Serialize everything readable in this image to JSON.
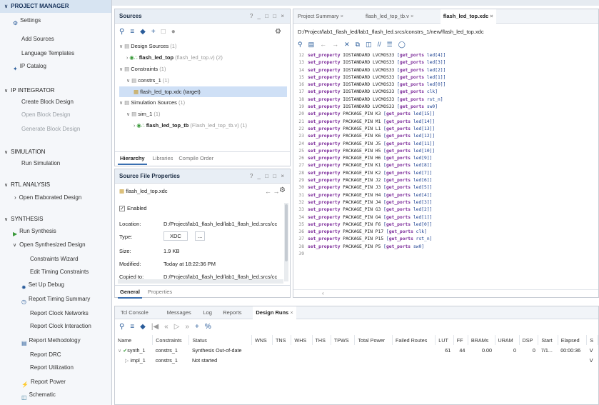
{
  "nav": {
    "items": [
      {
        "label": "PROJECT MANAGER",
        "kind": "section-top"
      },
      {
        "label": "Settings",
        "kind": "item"
      },
      {
        "label": "Add Sources",
        "kind": "sub"
      },
      {
        "label": "Language Templates",
        "kind": "sub"
      },
      {
        "label": "IP Catalog",
        "kind": "item"
      },
      {
        "label": "IP INTEGRATOR",
        "kind": "section"
      },
      {
        "label": "Create Block Design",
        "kind": "sub"
      },
      {
        "label": "Open Block Design",
        "kind": "sub-dim"
      },
      {
        "label": "Generate Block Design",
        "kind": "sub-dim"
      },
      {
        "label": "SIMULATION",
        "kind": "section"
      },
      {
        "label": "Run Simulation",
        "kind": "sub"
      },
      {
        "label": "RTL ANALYSIS",
        "kind": "section"
      },
      {
        "label": "Open Elaborated Design",
        "kind": "sub"
      },
      {
        "label": "SYNTHESIS",
        "kind": "section"
      },
      {
        "label": "Run Synthesis",
        "kind": "item"
      },
      {
        "label": "Open Synthesized Design",
        "kind": "item"
      },
      {
        "label": "Constraints Wizard",
        "kind": "sub2"
      },
      {
        "label": "Edit Timing Constraints",
        "kind": "sub2"
      },
      {
        "label": "Set Up Debug",
        "kind": "sub2i"
      },
      {
        "label": "Report Timing Summary",
        "kind": "sub2i"
      },
      {
        "label": "Report Clock Networks",
        "kind": "sub2"
      },
      {
        "label": "Report Clock Interaction",
        "kind": "sub2"
      },
      {
        "label": "Report Methodology",
        "kind": "sub2i"
      },
      {
        "label": "Report DRC",
        "kind": "sub2"
      },
      {
        "label": "Report Utilization",
        "kind": "sub2"
      },
      {
        "label": "Report Power",
        "kind": "sub2i"
      },
      {
        "label": "Schematic",
        "kind": "sub2i"
      }
    ]
  },
  "sources": {
    "title": "Sources",
    "controls": "? _ □ □ ×",
    "tree": [
      {
        "text": "Design Sources",
        "count": "(1)",
        "depth": 0
      },
      {
        "text": "flash_led_top",
        "extra": "(flash_led_top.v) (2)",
        "depth": 1,
        "bold": true
      },
      {
        "text": "Constraints",
        "count": "(1)",
        "depth": 0
      },
      {
        "text": "constrs_1",
        "count": "(1)",
        "depth": 1
      },
      {
        "text": "flash_led_top.xdc (target)",
        "depth": 2,
        "selected": true
      },
      {
        "text": "Simulation Sources",
        "count": "(1)",
        "depth": 0
      },
      {
        "text": "sim_1",
        "count": "(1)",
        "depth": 1
      },
      {
        "text": "flash_led_top_tb",
        "extra": "(Flash_led_top_tb.v) (1)",
        "depth": 2,
        "bold": true
      }
    ],
    "tabs": [
      "Hierarchy",
      "Libraries",
      "Compile Order"
    ]
  },
  "props": {
    "title": "Source File Properties",
    "controls": "? _ □ □ ×",
    "file": "flash_led_top.xdc",
    "enabled_label": "Enabled",
    "fields": [
      {
        "label": "Location:",
        "value": "D:/Project/lab1_flash_led/lab1_flash_led.srcs/cc"
      },
      {
        "label": "Type:",
        "value": "XDC"
      },
      {
        "label": "Size:",
        "value": "1.9 KB"
      },
      {
        "label": "Modified:",
        "value": "Today at 18:22:36 PM"
      },
      {
        "label": "Copied to:",
        "value": "D:/Project/lab1_flash_led/lab1_flash_led.srcs/cc"
      }
    ],
    "tabs": [
      "General",
      "Properties"
    ]
  },
  "editor": {
    "tabs": [
      "Project Summary",
      "flash_led_top_tb.v",
      "flash_led_top.xdc"
    ],
    "path": "D:/Project/lab1_flash_led/lab1_flash_led.srcs/constrs_1/new/flash_led_top.xdc",
    "lines": [
      {
        "n": "12",
        "kind": "io",
        "arg": "led[4]"
      },
      {
        "n": "13",
        "kind": "io",
        "arg": "led[3]"
      },
      {
        "n": "14",
        "kind": "io",
        "arg": "led[2]"
      },
      {
        "n": "15",
        "kind": "io",
        "arg": "led[1]"
      },
      {
        "n": "16",
        "kind": "io",
        "arg": "led[0]"
      },
      {
        "n": "17",
        "kind": "io",
        "arg": "clk"
      },
      {
        "n": "18",
        "kind": "io",
        "arg": "rst_n"
      },
      {
        "n": "19",
        "kind": "io",
        "arg": "sw0"
      },
      {
        "n": "20",
        "kind": "pin",
        "pin": "K3",
        "arg": "led[15]"
      },
      {
        "n": "21",
        "kind": "pin",
        "pin": "M1",
        "arg": "led[14]"
      },
      {
        "n": "22",
        "kind": "pin",
        "pin": "L1",
        "arg": "led[13]"
      },
      {
        "n": "23",
        "kind": "pin",
        "pin": "K6",
        "arg": "led[12]"
      },
      {
        "n": "24",
        "kind": "pin",
        "pin": "J5",
        "arg": "led[11]"
      },
      {
        "n": "25",
        "kind": "pin",
        "pin": "H5",
        "arg": "led[10]"
      },
      {
        "n": "26",
        "kind": "pin",
        "pin": "H6",
        "arg": "led[9]"
      },
      {
        "n": "27",
        "kind": "pin",
        "pin": "K1",
        "arg": "led[8]"
      },
      {
        "n": "28",
        "kind": "pin",
        "pin": "K2",
        "arg": "led[7]"
      },
      {
        "n": "29",
        "kind": "pin",
        "pin": "J2",
        "arg": "led[6]"
      },
      {
        "n": "30",
        "kind": "pin",
        "pin": "J3",
        "arg": "led[5]"
      },
      {
        "n": "31",
        "kind": "pin",
        "pin": "H4",
        "arg": "led[4]"
      },
      {
        "n": "32",
        "kind": "pin",
        "pin": "J4",
        "arg": "led[3]"
      },
      {
        "n": "33",
        "kind": "pin",
        "pin": "G3",
        "arg": "led[2]"
      },
      {
        "n": "34",
        "kind": "pin",
        "pin": "G4",
        "arg": "led[1]"
      },
      {
        "n": "35",
        "kind": "pin",
        "pin": "F6",
        "arg": "led[0]"
      },
      {
        "n": "36",
        "kind": "pin",
        "pin": "P17",
        "arg": "clk"
      },
      {
        "n": "37",
        "kind": "pin",
        "pin": "P15",
        "arg": "rst_n"
      },
      {
        "n": "38",
        "kind": "pin",
        "pin": "P5",
        "arg": "sw0"
      },
      {
        "n": "39",
        "kind": "blank"
      }
    ],
    "kw_set": "set_property",
    "kw_io": "IOSTANDARD LVCMOS33",
    "kw_pin": "PACKAGE_PIN",
    "kw_get": "get_ports"
  },
  "runs": {
    "tabs": [
      "Tcl Console",
      "Messages",
      "Log",
      "Reports",
      "Design Runs"
    ],
    "active_tab": "Design Runs",
    "columns": [
      "Name",
      "Constraints",
      "Status",
      "WNS",
      "TNS",
      "WHS",
      "THS",
      "TPWS",
      "Total Power",
      "Failed Routes",
      "LUT",
      "FF",
      "BRAMs",
      "URAM",
      "DSP",
      "Start",
      "Elapsed",
      "S"
    ],
    "rows": [
      {
        "name": "synth_1",
        "constraints": "constrs_1",
        "status": "Synthesis Out-of-date",
        "lut": "61",
        "ff": "44",
        "brams": "0.00",
        "uram": "0",
        "dsp": "0",
        "start": "7/1...",
        "elapsed": "00:00:36",
        "s": "V"
      },
      {
        "name": "impl_1",
        "constraints": "constrs_1",
        "status": "Not started",
        "lut": "",
        "ff": "",
        "brams": "",
        "uram": "",
        "dsp": "",
        "start": "",
        "elapsed": "",
        "s": "V"
      }
    ]
  },
  "colors": {
    "accent": "#3a6fb0",
    "selected": "#cfe0f6",
    "header": "#e8eef5",
    "keyword": "#7b2a99"
  }
}
